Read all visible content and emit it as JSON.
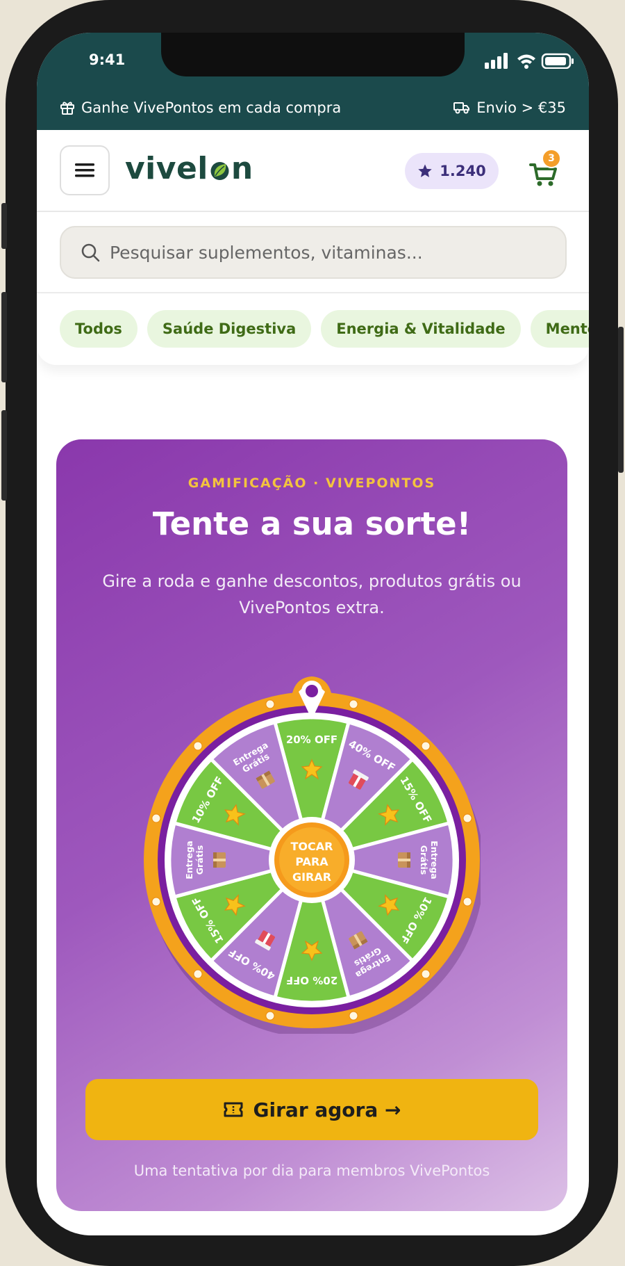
{
  "status_bar": {
    "time": "9:41"
  },
  "promo_bar": {
    "left_text": "Ganhe VivePontos em cada compra",
    "right_text": "Envio > €35",
    "left_icon": "gift-icon",
    "right_icon": "truck-icon"
  },
  "header": {
    "logo_before": "vivel",
    "logo_after": "n",
    "points": "1.240",
    "cart_count": "3"
  },
  "search": {
    "placeholder": "Pesquisar suplementos, vitaminas..."
  },
  "categories": [
    "Todos",
    "Saúde Digestiva",
    "Energia & Vitalidade",
    "Mente"
  ],
  "game": {
    "eyebrow": "GAMIFICAÇÃO · VIVEPONTOS",
    "title": "Tente a sua sorte!",
    "subtitle": "Gire a roda e ganhe descontos, produtos grátis ou VivePontos extra.",
    "center_line1": "TOCAR",
    "center_line2": "PARA",
    "center_line3": "GIRAR",
    "segments": [
      {
        "label": "20% OFF",
        "icon": "star"
      },
      {
        "label": "40% OFF",
        "icon": "gift"
      },
      {
        "label": "15% OFF",
        "icon": "star"
      },
      {
        "label": "Entrega Grátis",
        "icon": "box"
      },
      {
        "label": "10% OFF",
        "icon": "star"
      },
      {
        "label": "Entrega Grátis",
        "icon": "box"
      },
      {
        "label": "20% OFF",
        "icon": "star"
      },
      {
        "label": "40% OFF",
        "icon": "gift"
      },
      {
        "label": "15% OFF",
        "icon": "star"
      },
      {
        "label": "Entrega Grátis",
        "icon": "box"
      },
      {
        "label": "10% OFF",
        "icon": "star"
      },
      {
        "label": "Entrega Grátis",
        "icon": "box"
      }
    ],
    "cta": "Girar agora →",
    "note": "Uma tentativa por dia para membros VivePontos"
  },
  "colors": {
    "brand_dark": "#1b4a4c",
    "wheel_orange": "#f4a21c",
    "wheel_purple_ring": "#7a1fa0",
    "segment_green": "#78c843",
    "segment_purple": "#b07fd0",
    "cta_yellow": "#f0b411"
  }
}
